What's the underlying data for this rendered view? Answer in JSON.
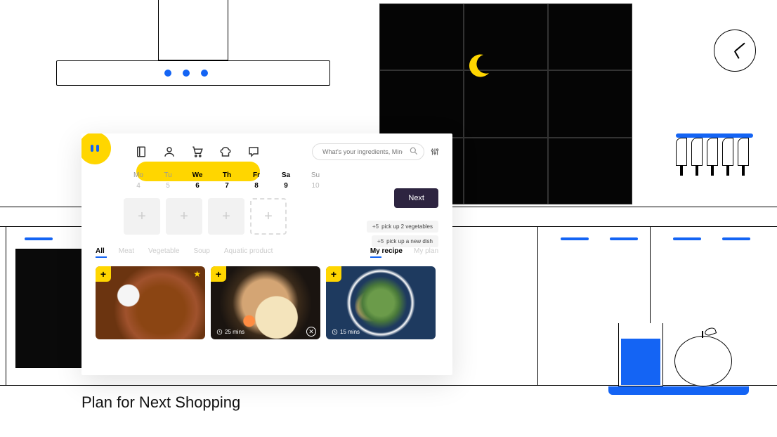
{
  "caption": "Plan for Next Shopping",
  "search": {
    "placeholder": "What's your ingredients, Ming?"
  },
  "nav": {
    "items": [
      "book-icon",
      "user-icon",
      "cart-icon",
      "chef-icon",
      "chat-icon"
    ],
    "active_index": 2
  },
  "week": {
    "days": [
      {
        "label": "Mo",
        "date": "4",
        "bold": false
      },
      {
        "label": "Tu",
        "date": "5",
        "bold": false
      },
      {
        "label": "We",
        "date": "6",
        "bold": true
      },
      {
        "label": "Th",
        "date": "7",
        "bold": true
      },
      {
        "label": "Fr",
        "date": "8",
        "bold": true
      },
      {
        "label": "Sa",
        "date": "9",
        "bold": true
      },
      {
        "label": "Su",
        "date": "10",
        "bold": false
      }
    ]
  },
  "next_button": "Next",
  "suggestions": [
    {
      "num": "+5",
      "text": "pick up 2 vegetables"
    },
    {
      "num": "+5",
      "text": "pick up a new dish"
    }
  ],
  "tabs": {
    "left": [
      "All",
      "Meat",
      "Vegetable",
      "Soup",
      "Aquatic product"
    ],
    "right": [
      "My recipe",
      "My plan"
    ],
    "left_active": 0,
    "right_active": 0
  },
  "recipes": [
    {
      "name": "mapo-tofu",
      "time": "",
      "starred": true
    },
    {
      "name": "ramen",
      "time": "25 mins",
      "starred": false,
      "closable": true
    },
    {
      "name": "stir-fry-veg",
      "time": "15 mins",
      "starred": false
    }
  ],
  "slot_plus": "+"
}
